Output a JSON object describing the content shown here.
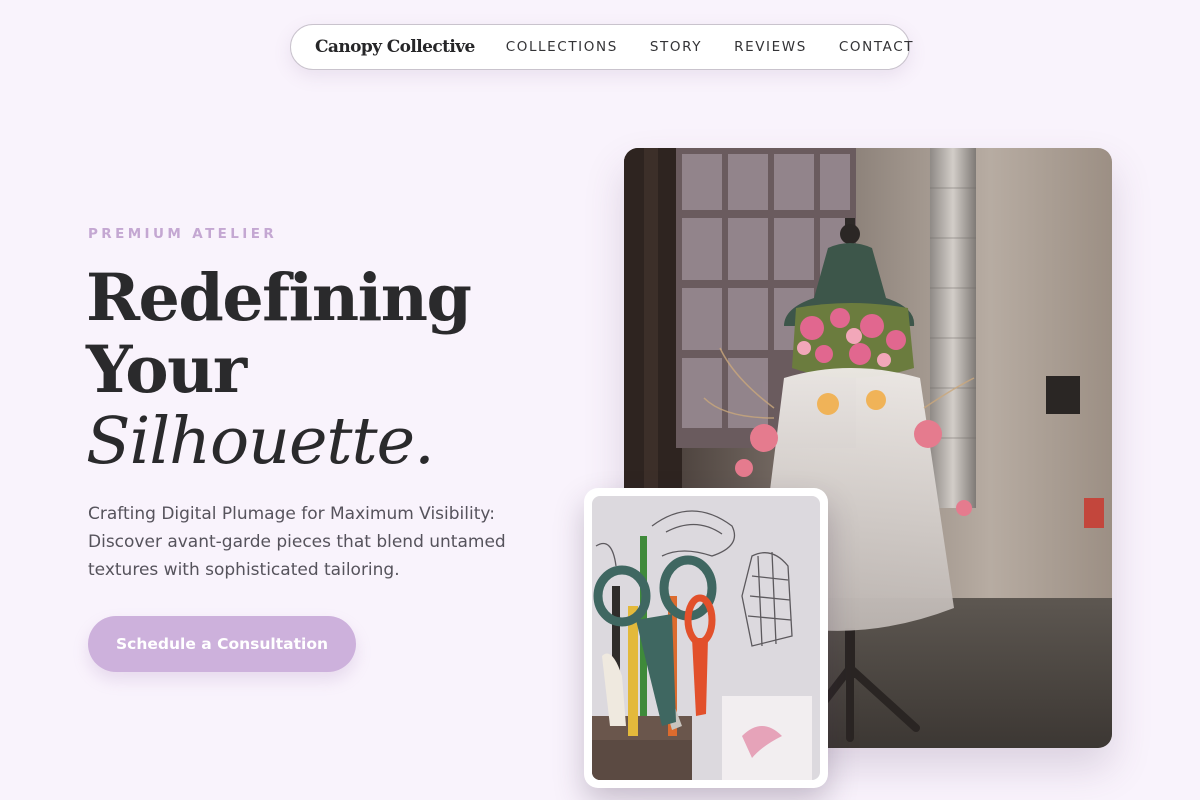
{
  "nav": {
    "brand": "Canopy Collective",
    "links": [
      "COLLECTIONS",
      "STORY",
      "REVIEWS",
      "CONTACT"
    ]
  },
  "hero": {
    "eyebrow": "PREMIUM ATELIER",
    "headline_line1": "Redefining",
    "headline_line2": "Your",
    "headline_line3": "Silhouette.",
    "description": "Crafting Digital Plumage for Maximum Visibility: Discover avant-garde pieces that blend untamed textures with sophisticated tailoring.",
    "cta_label": "Schedule a Consultation"
  },
  "images": {
    "main_photo": "floral-dress-mannequin-photo",
    "inset_photo": "scissors-and-tools-photo"
  },
  "colors": {
    "background": "#f9f3fc",
    "accent": "#cdb1dc",
    "eyebrow": "#c4a7d2",
    "text_dark": "#2a2a2c"
  }
}
